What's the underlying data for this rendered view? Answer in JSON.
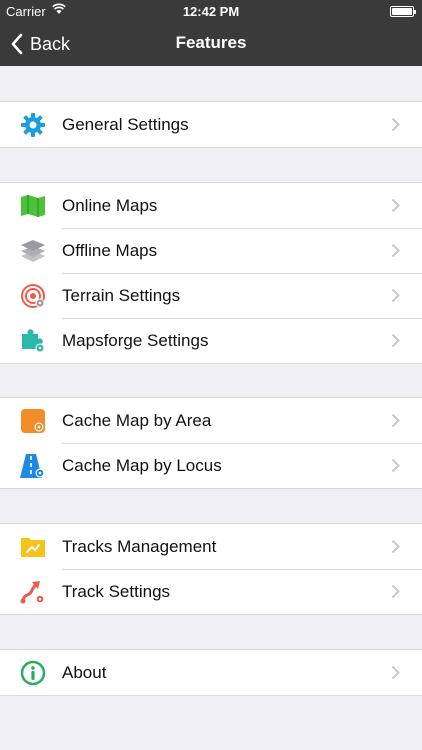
{
  "status": {
    "carrier": "Carrier",
    "time": "12:42 PM"
  },
  "nav": {
    "back_label": "Back",
    "title": "Features"
  },
  "groups": [
    {
      "items": [
        {
          "label": "General Settings",
          "icon": "gear-icon"
        }
      ]
    },
    {
      "items": [
        {
          "label": "Online Maps",
          "icon": "map-icon"
        },
        {
          "label": "Offline Maps",
          "icon": "layers-icon"
        },
        {
          "label": "Terrain Settings",
          "icon": "target-icon"
        },
        {
          "label": "Mapsforge Settings",
          "icon": "puzzle-icon"
        }
      ]
    },
    {
      "items": [
        {
          "label": "Cache Map by Area",
          "icon": "cache-area-icon"
        },
        {
          "label": "Cache Map by Locus",
          "icon": "cache-locus-icon"
        }
      ]
    },
    {
      "items": [
        {
          "label": "Tracks Management",
          "icon": "folder-icon"
        },
        {
          "label": "Track Settings",
          "icon": "track-icon"
        }
      ]
    },
    {
      "items": [
        {
          "label": "About",
          "icon": "info-icon"
        }
      ]
    }
  ],
  "colors": {
    "navbar": "#3a3a3a",
    "background": "#efeff4",
    "gear": "#1a9fdc",
    "map": "#4cc23a",
    "layers": "#9a9aa0",
    "target": "#ef5a4b",
    "puzzle": "#2bb8a6",
    "cache_area": "#f28c28",
    "cache_locus": "#1e88e5",
    "folder": "#f7c21a",
    "track": "#ef5a4b",
    "info": "#27ae60"
  }
}
